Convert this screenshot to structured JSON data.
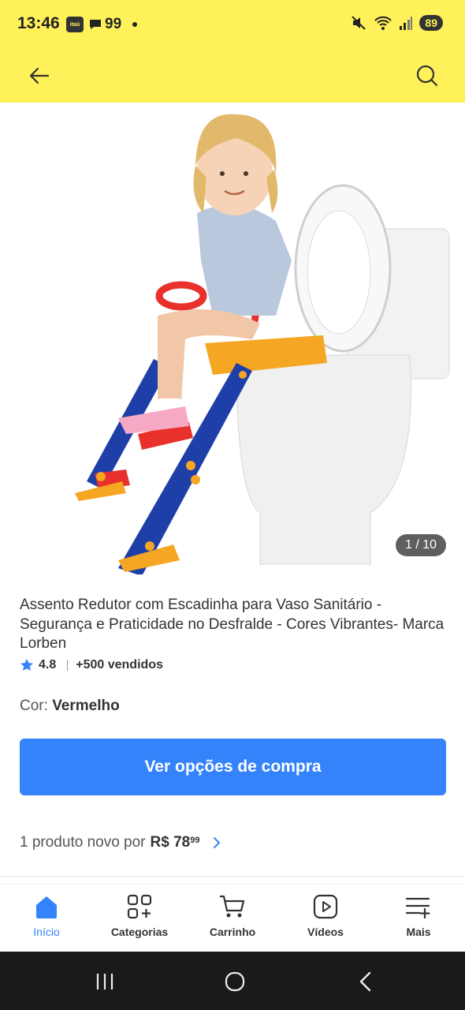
{
  "status": {
    "time": "13:46",
    "badge": "itaú",
    "chat_count": "99",
    "battery": "89"
  },
  "gallery": {
    "counter": "1 / 10"
  },
  "product": {
    "title": "Assento Redutor com Escadinha para Vaso Sanitário - Segurança e Praticidade no Desfralde - Cores Vibrantes- Marca Lorben",
    "rating": "4.8",
    "sold": "+500 vendidos",
    "color_label": "Cor: ",
    "color_value": "Vermelho",
    "buy_label": "Ver opções de compra",
    "offer_text": "1 produto novo por",
    "price_main": "R$ 78",
    "price_cents": "99"
  },
  "tabs": [
    {
      "label": "Início",
      "icon": "home-icon"
    },
    {
      "label": "Categorias",
      "icon": "categories-icon"
    },
    {
      "label": "Carrinho",
      "icon": "cart-icon"
    },
    {
      "label": "Vídeos",
      "icon": "video-icon"
    },
    {
      "label": "Mais",
      "icon": "more-icon"
    }
  ],
  "colors": {
    "brand_yellow": "#fff159",
    "accent_blue": "#3483fa"
  }
}
